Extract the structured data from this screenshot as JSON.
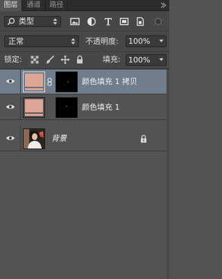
{
  "tabs": [
    {
      "label": "图层",
      "active": true
    },
    {
      "label": "通道",
      "active": false
    },
    {
      "label": "路径",
      "active": false
    }
  ],
  "filter": {
    "kind_label": "类型",
    "icons": [
      "image-filter-icon",
      "adjustment-filter-icon",
      "type-filter-icon",
      "shape-filter-icon",
      "smart-object-filter-icon"
    ]
  },
  "blend": {
    "mode": "正常",
    "opacity_label": "不透明度:",
    "opacity": "100%"
  },
  "lock": {
    "label": "锁定:",
    "fill_label": "填充:",
    "fill": "100%"
  },
  "layers": [
    {
      "name": "颜色填充 1 拷贝",
      "selected": true,
      "type": "color-fill",
      "fill_color": "#dba696",
      "linked_mask": true
    },
    {
      "name": "颜色填充 1",
      "selected": false,
      "type": "color-fill",
      "fill_color": "#dba696",
      "linked_mask": false
    },
    {
      "name": "背景",
      "selected": false,
      "type": "background",
      "locked": true
    }
  ],
  "colors": {
    "panel_bg": "#535353",
    "selected_row": "#6f7d8d",
    "swatch": "#dba696"
  }
}
